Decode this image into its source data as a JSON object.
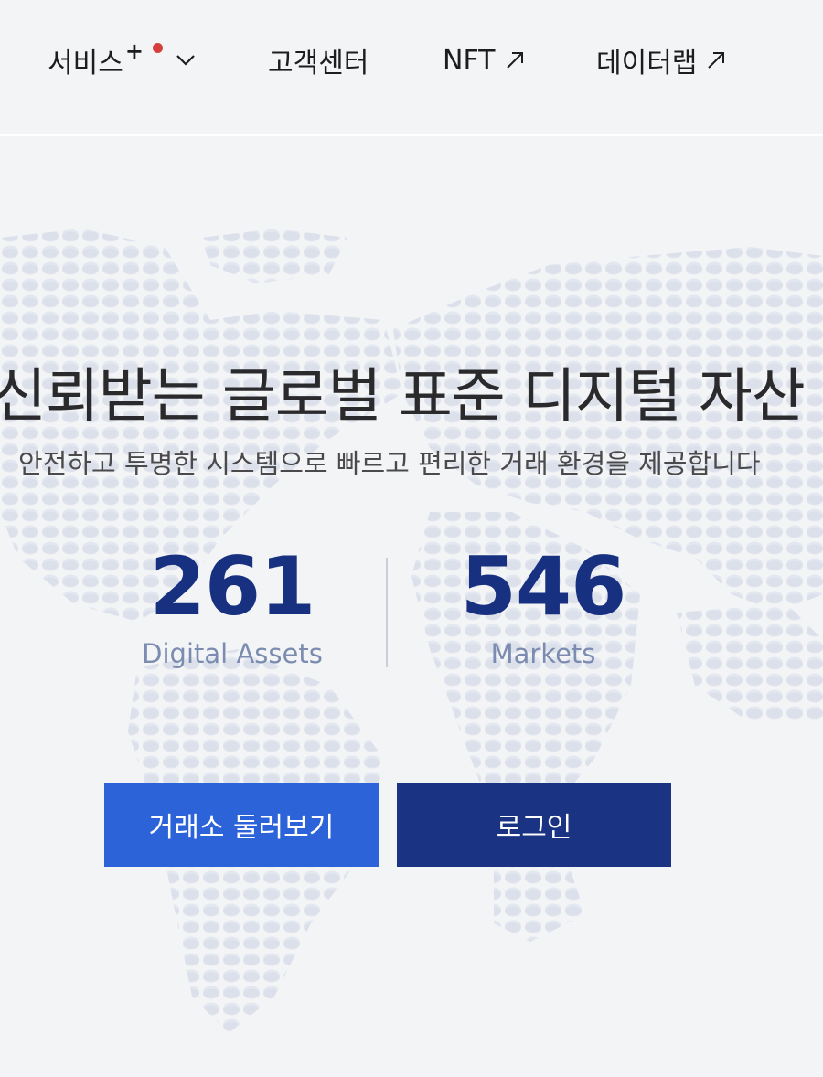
{
  "nav": {
    "services_label": "서비스",
    "services_badge": "+",
    "support_label": "고객센터",
    "nft_label": "NFT",
    "datalab_label": "데이터랩"
  },
  "hero": {
    "headline": "신뢰받는 글로벌 표준 디지털 자산",
    "subline": "안전하고 투명한 시스템으로 빠르고 편리한 거래 환경을 제공합니다"
  },
  "stats": {
    "assets_value": "261",
    "assets_label": "Digital Assets",
    "markets_value": "546",
    "markets_label": "Markets"
  },
  "actions": {
    "explore_label": "거래소 둘러보기",
    "login_label": "로그인"
  },
  "colors": {
    "accent_blue": "#2c63d9",
    "navy": "#1a3383",
    "number_navy": "#17307f",
    "notify_red": "#d63e3e"
  }
}
